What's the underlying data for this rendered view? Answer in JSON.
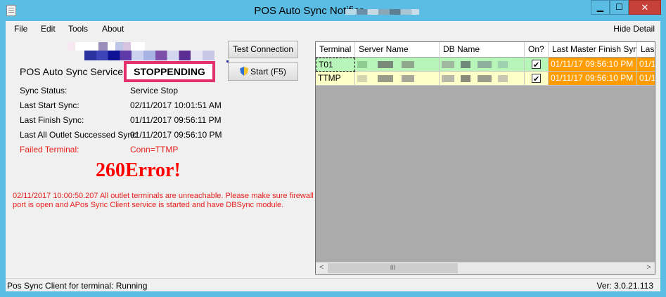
{
  "window": {
    "title": "POS Auto Sync Notifier -",
    "min_glyph": "▁",
    "max_glyph": "☐",
    "close_glyph": "✕"
  },
  "menu": {
    "items": [
      "File",
      "Edit",
      "Tools",
      "About"
    ],
    "hide_detail": "Hide Detail"
  },
  "service": {
    "label": "POS Auto Sync Service:",
    "status": "STOPPENDING",
    "status_border_color": "#e3326b"
  },
  "buttons": {
    "test_connection": "Test Connection",
    "start": "Start (F5)"
  },
  "info": [
    {
      "label": "Sync Status:",
      "value": "Service Stop"
    },
    {
      "label": "Last Start Sync:",
      "value": "02/11/2017 10:01:51 AM"
    },
    {
      "label": "Last Finish Sync:",
      "value": "01/11/2017 09:56:11 PM"
    },
    {
      "label": "Last All Outlet Successed Sync:",
      "value": "01/11/2017 09:56:10 PM"
    },
    {
      "label": "Failed Terminal:",
      "value": "Conn=TTMP"
    }
  ],
  "error": {
    "big": "260Error!",
    "message": "02/11/2017 10:00:50.207 All outlet terminals are unreachable. Please make sure firewall port is open and APos Sync Client service is started and have DBSync module.",
    "color": "#e8201c"
  },
  "grid": {
    "columns": [
      "Terminal",
      "Server Name",
      "DB Name",
      "On?",
      "Last Master Finish Sync",
      "Las"
    ],
    "rows": [
      {
        "terminal": "T01",
        "on": true,
        "last_master": "01/11/17 09:56:10 PM",
        "last": "01/1"
      },
      {
        "terminal": "TTMP",
        "on": true,
        "last_master": "01/11/17 09:56:10 PM",
        "last": "01/1"
      }
    ],
    "colors": {
      "green_row": "#b8f5b8",
      "yellow_row": "#ffffc8",
      "orange_cell": "#ff9d00"
    },
    "scroll_thumb_glyph": "III"
  },
  "status": {
    "left": "Pos Sync Client for terminal: Running",
    "right": "Ver: 3.0.21.113"
  }
}
